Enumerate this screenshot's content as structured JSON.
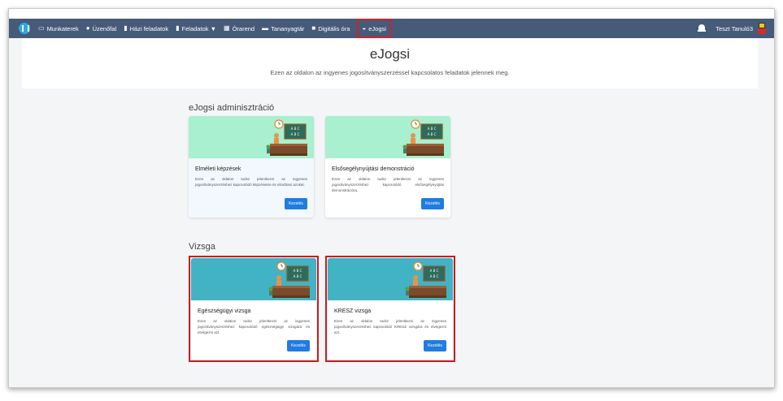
{
  "nav": {
    "items": [
      {
        "icon": "laptop-icon",
        "glyph": "▭",
        "label": "Munkaterek"
      },
      {
        "icon": "chat-icon",
        "glyph": "●",
        "label": "Üzenőfal"
      },
      {
        "icon": "document-icon",
        "glyph": "▮",
        "label": "Házi feladatok"
      },
      {
        "icon": "clipboard-icon",
        "glyph": "▮",
        "label": "Feladatok ▼"
      },
      {
        "icon": "calendar-icon",
        "glyph": "▦",
        "label": "Órarend"
      },
      {
        "icon": "book-icon",
        "glyph": "▬",
        "label": "Tananyagtár"
      },
      {
        "icon": "video-icon",
        "glyph": "■",
        "label": "Digitális óra"
      },
      {
        "icon": "car-icon",
        "glyph": "◒",
        "label": "eJogsi"
      }
    ],
    "user": "Teszt Tanuló3",
    "colors": {
      "bar": "#465b79",
      "logo": "#2fa8e0",
      "highlight": "#c41e24"
    }
  },
  "header": {
    "title": "eJogsi",
    "subtitle": "Ezen az oldalon az ingyenes jogosítványszerzéssel kapcsolatos feladatok jelennek meg."
  },
  "sections": {
    "admin": {
      "title": "eJogsi adminisztráció",
      "cards": [
        {
          "title": "Elméleti képzések",
          "text": "Ezen az oldalon tudsz jelentkezni az ingyenes jogosítványszerzéshez kapcsolódó képzésekre és elindítani azokat.",
          "button": "Kezelés",
          "image_bg": "#a8f0cf"
        },
        {
          "title": "Elsősegélynyújtási demonstráció",
          "text": "Ezen az oldalon tudsz jelentkezni az ingyenes jogosítványszerzéshez kapcsolódó elsősegélynyújtás demonstrációra.",
          "button": "Kezelés",
          "image_bg": "#a8f0cf"
        }
      ]
    },
    "exam": {
      "title": "Vizsga",
      "cards": [
        {
          "title": "Egészségügyi vizsga",
          "text": "Ezen az oldalon tudsz jelentkezni az ingyenes jogosítványszerzéshez kapcsolódó egészségügyi vizsgára és elvégezni azt.",
          "button": "Kezelés",
          "image_bg": "#41b3c4"
        },
        {
          "title": "KRESZ vizsga",
          "text": "Ezen az oldalon tudsz jelentkezni az ingyenes jogosítványszerzéshez kapcsolódó KRESZ vizsgára és elvégezni azt.",
          "button": "Kezelés",
          "image_bg": "#41b3c4"
        }
      ]
    }
  },
  "illustration": {
    "board_text_1": "A B C",
    "board_text_2": "A B C"
  }
}
